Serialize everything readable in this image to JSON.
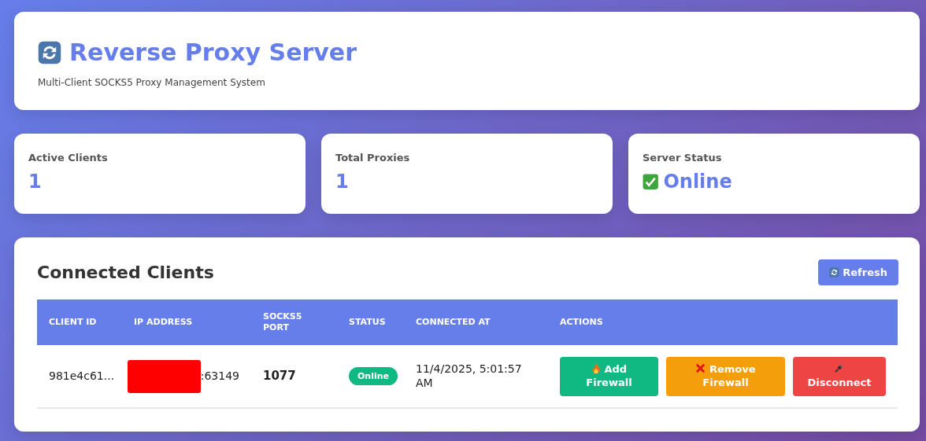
{
  "header": {
    "title": "Reverse Proxy Server",
    "subtitle": "Multi-Client SOCKS5 Proxy Management System"
  },
  "stats": [
    {
      "label": "Active Clients",
      "value": "1",
      "kind": "count"
    },
    {
      "label": "Total Proxies",
      "value": "1",
      "kind": "count"
    },
    {
      "label": "Server Status",
      "value": "Online",
      "kind": "status"
    }
  ],
  "clients": {
    "title": "Connected Clients",
    "refresh_button": "Refresh",
    "columns": [
      "CLIENT ID",
      "IP ADDRESS",
      "SOCKS5 PORT",
      "STATUS",
      "CONNECTED AT",
      "ACTIONS"
    ],
    "rows": [
      {
        "client_id": "981e4c61...",
        "ip_redacted": true,
        "ip_address": ":63149",
        "socks5_port": "1077",
        "status": "Online",
        "connected_at": "11/4/2025, 5:01:57 AM",
        "actions": [
          {
            "kind": "add_firewall",
            "label": "Add Firewall"
          },
          {
            "kind": "remove_firewall",
            "label": "Remove Firewall"
          },
          {
            "kind": "disconnect",
            "label": "Disconnect"
          }
        ]
      }
    ]
  }
}
